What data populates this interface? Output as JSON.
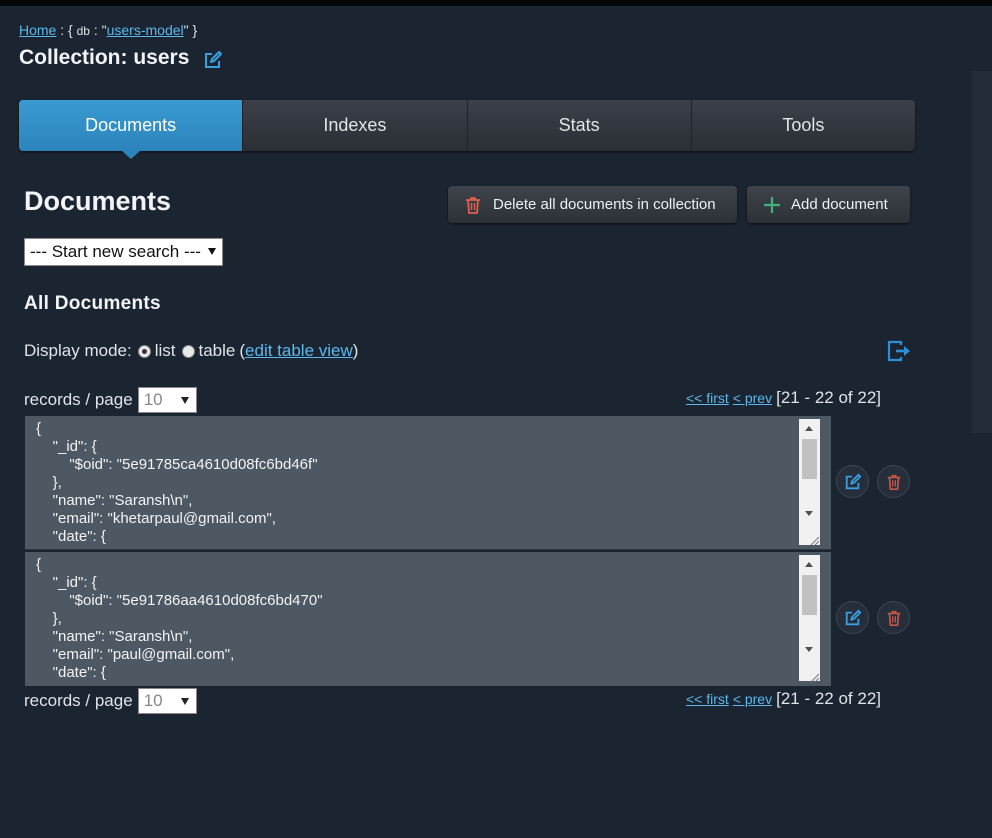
{
  "breadcrumb": {
    "home": "Home",
    "sep1": " : { ",
    "db_key": "db",
    "sep2": " : \"",
    "db_name": "users-model",
    "sep3": "\" }"
  },
  "title": "Collection: users",
  "tabs": [
    "Documents",
    "Indexes",
    "Stats",
    "Tools"
  ],
  "active_tab": "Documents",
  "section_title": "Documents",
  "buttons": {
    "delete_all": "Delete all documents in collection",
    "add_document": "Add document"
  },
  "search": {
    "selected": "--- Start new search ---"
  },
  "subtitle": "All Documents",
  "display_mode": {
    "label": "Display mode:",
    "list": "list",
    "table": "table",
    "paren_open": "(",
    "edit_link": "edit table view",
    "paren_close": ")",
    "selected": "list"
  },
  "records_per_page": {
    "label": "records / page",
    "value": "10"
  },
  "pager": {
    "first": "<< first",
    "prev": "< prev",
    "range": "[21 - 22 of 22]"
  },
  "documents": [
    {
      "text": "{\n    \"_id\": {\n        \"$oid\": \"5e91785ca4610d08fc6bd46f\"\n    },\n    \"name\": \"Saransh\\n\",\n    \"email\": \"khetarpaul@gmail.com\",\n    \"date\": {"
    },
    {
      "text": "{\n    \"_id\": {\n        \"$oid\": \"5e91786aa4610d08fc6bd470\"\n    },\n    \"name\": \"Saransh\\n\",\n    \"email\": \"paul@gmail.com\",\n    \"date\": {"
    }
  ],
  "colors": {
    "background": "#1b2431",
    "accent": "#2b84bb",
    "link": "#5cb8ec",
    "delete": "#e0604f",
    "add": "#3fb37a"
  },
  "icons": {
    "title_edit": "edit-icon",
    "delete_all": "trash-icon",
    "add": "plus-icon",
    "export": "export-icon",
    "row_edit": "edit-icon",
    "row_delete": "trash-icon"
  }
}
